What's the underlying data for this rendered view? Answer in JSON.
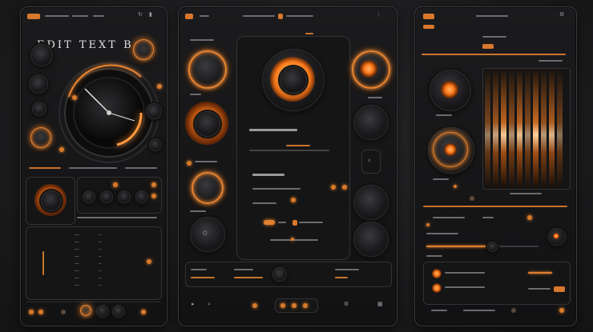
{
  "panel1": {
    "title": "EDIT TEXT BG",
    "list_left": [
      "---",
      "---",
      "---",
      "---",
      "---",
      "---",
      "---",
      "---"
    ],
    "list_right": [
      "--",
      "--",
      "--",
      "--",
      "--",
      "--",
      "--",
      "--"
    ]
  },
  "panel2": {
    "heading": "",
    "subheading": ""
  },
  "panel3": {},
  "colors": {
    "accent": "#e68432",
    "bg": "#1c1c1e",
    "panel": "#141415"
  },
  "icons": [
    "search-icon",
    "settings-icon",
    "back-arrow-icon",
    "play-icon",
    "power-icon"
  ]
}
